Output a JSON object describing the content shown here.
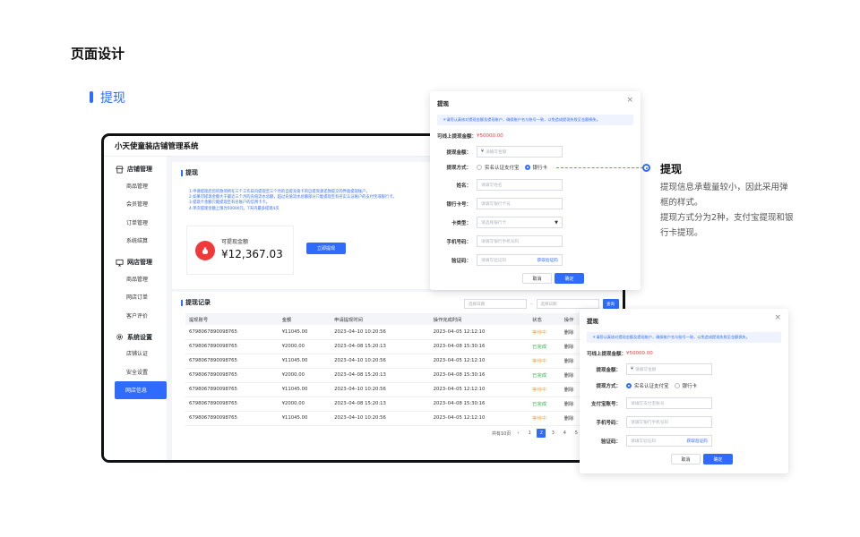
{
  "page_title": "页面设计",
  "section_title": "提现",
  "app": {
    "title": "小天使童装店铺管理系统",
    "sidebar": [
      {
        "group": "店铺管理",
        "icon": "store-icon",
        "items": [
          "商品管理",
          "会员管理",
          "订单管理",
          "系统结算"
        ]
      },
      {
        "group": "网店管理",
        "icon": "monitor-icon",
        "items": [
          "商品管理",
          "网店订单",
          "客户评价"
        ]
      },
      {
        "group": "系统设置",
        "icon": "gear-icon",
        "items": [
          "店铺认证",
          "安全设置",
          "网店信息"
        ]
      }
    ],
    "active_item": "网店信息",
    "withdraw_card": {
      "title": "提现",
      "notes": [
        "1.申请提现后您的款项将在三个工作日内提现至三个月的自提充值卡的自提资源还款提交的界面提现账户。",
        "2.如果可提现金额大于最近三个月的充值流水总额，超过充值流水总额部分只能提现至有名实认证账户的支付宝或银行卡。",
        "3.提现卡金额只能提现至有名账户的信用卡卡。",
        "4.单次提现金额上限为50000元，7天内最多提现4次"
      ],
      "balance_label": "可提现金额",
      "balance_amount": "¥12,367.03",
      "withdraw_button": "立即提现"
    },
    "records": {
      "title": "提现记录",
      "start_date_placeholder": "选择日期",
      "end_date_placeholder": "选择日期",
      "date_separator": "–",
      "query_button": "查询",
      "columns": [
        "提现账号",
        "金额",
        "申请提现时间",
        "操作完成时间",
        "状态",
        "操作"
      ],
      "rows": [
        {
          "account": "6798067890098765",
          "amount": "¥11045.00",
          "apply": "2023–04–10 10:20:56",
          "done": "2023–04–05 12:12:10",
          "status": "等待中",
          "status_type": "pending",
          "action": "删除"
        },
        {
          "account": "6798067890098765",
          "amount": "¥2000.00",
          "apply": "2023–04–08 15:20:13",
          "done": "2023–04–08 15:30:16",
          "status": "已完成",
          "status_type": "done",
          "action": "删除"
        },
        {
          "account": "6798067890098765",
          "amount": "¥11045.00",
          "apply": "2023–04–10 10:20:56",
          "done": "2023–04–05 12:12:10",
          "status": "等待中",
          "status_type": "pending",
          "action": "删除"
        },
        {
          "account": "6798067890098765",
          "amount": "¥2000.00",
          "apply": "2023–04–08 15:20:13",
          "done": "2023–04–08 15:30:16",
          "status": "已完成",
          "status_type": "done",
          "action": "删除"
        },
        {
          "account": "6798067890098765",
          "amount": "¥11045.00",
          "apply": "2023–04–10 10:20:56",
          "done": "2023–04–05 12:12:10",
          "status": "等待中",
          "status_type": "pending",
          "action": "删除"
        },
        {
          "account": "6798067890098765",
          "amount": "¥2000.00",
          "apply": "2023–04–08 15:20:13",
          "done": "2023–04–08 15:30:16",
          "status": "已完成",
          "status_type": "done",
          "action": "删除"
        },
        {
          "account": "6798067890098765",
          "amount": "¥11045.00",
          "apply": "2023–04–10 10:20:56",
          "done": "2023–04–05 12:12:10",
          "status": "等待中",
          "status_type": "pending",
          "action": "删除"
        }
      ],
      "pager": {
        "total_text": "共有10页",
        "pages": [
          "1",
          "2",
          "3",
          "4",
          "5"
        ],
        "current": "2"
      }
    }
  },
  "dialog_bank": {
    "title": "提现",
    "notice": "＊请您认真核对提现金额及提现账户，确保账户名与账号一致，以免造成提现失败至金额损失。",
    "max_label": "可线上提现金额：",
    "max_value": "¥50000.00",
    "amount_label": "提现金额：",
    "amount_prefix": "¥",
    "amount_placeholder": "请填写金额",
    "method_label": "提现方式：",
    "method_options": [
      "实名认证支付宝",
      "银行卡"
    ],
    "method_selected": "银行卡",
    "name_label": "姓名：",
    "name_placeholder": "请填写姓名",
    "card_label": "银行卡号：",
    "card_placeholder": "请填写银行卡号",
    "type_label": "卡类型：",
    "type_placeholder": "请选择银行卡",
    "phone_label": "手机号码：",
    "phone_placeholder": "请填写银行手机号码",
    "code_label": "验证码：",
    "code_placeholder": "请填写验证码",
    "code_link": "获取验证码",
    "cancel": "取消",
    "confirm": "确定"
  },
  "dialog_alipay": {
    "title": "提现",
    "notice": "＊请您认真核对提现金额及提现账户，确保账户名与账号一致，以免造成提现失败至金额损失。",
    "max_label": "可线上提现金额：",
    "max_value": "¥50000.00",
    "amount_label": "提现金额：",
    "amount_prefix": "¥",
    "amount_placeholder": "请填写金额",
    "method_label": "提现方式：",
    "method_options": [
      "实名认证支付宝",
      "银行卡"
    ],
    "method_selected": "实名认证支付宝",
    "account_label": "支付宝账号：",
    "account_placeholder": "请填写支付宝账号",
    "phone_label": "手机号码：",
    "phone_placeholder": "请填写银行手机号码",
    "code_label": "验证码：",
    "code_placeholder": "请填写验证码",
    "code_link": "获取验证码",
    "cancel": "取消",
    "confirm": "确定"
  },
  "description": {
    "title": "提现",
    "lines": [
      "提现信息承载量较小，因此采用弹框的样式。",
      "提现方式分为2种，支付宝提现和银行卡提现。"
    ]
  },
  "colors": {
    "accent": "#2f6bff",
    "pending": "#f5a623",
    "done": "#27b148",
    "danger": "#f03a3a"
  }
}
